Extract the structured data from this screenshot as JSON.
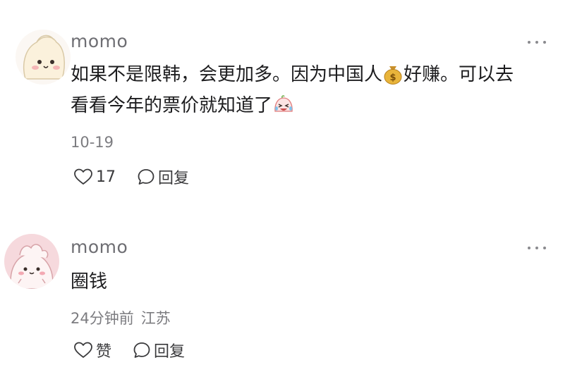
{
  "comments": [
    {
      "user": "momo",
      "text_lines": [
        [
          "如果不是限韩，会更加多。因为中国人",
          {
            "emoji": "money-bag-emoji"
          },
          "好赚。可以去"
        ],
        [
          "看看今年的票价就知道了",
          {
            "emoji": "crying-laughing-emoji"
          }
        ]
      ],
      "text_line_1a": "如果不是限韩，会更加多。因为中国人",
      "text_line_1b": "好赚。可以去",
      "text_line_2": "看看今年的票价就知道了",
      "time": "10-19",
      "location": "",
      "like_label": "17",
      "reply_label": "回复",
      "icons": [
        "heart-icon",
        "comment-bubble-icon",
        "more-dots-icon"
      ]
    },
    {
      "user": "momo",
      "text_line_1": "圈钱",
      "time": "24分钟前",
      "location": "江苏",
      "like_label": "赞",
      "reply_label": "回复",
      "icons": [
        "heart-icon",
        "comment-bubble-icon",
        "more-dots-icon"
      ]
    }
  ],
  "colors": {
    "username": "#6e6e73",
    "body_text": "#1c1c1e",
    "meta": "#7c7c80",
    "avatar_bg": "#f6d9dd",
    "emoji_gold": "#e8b43a"
  }
}
